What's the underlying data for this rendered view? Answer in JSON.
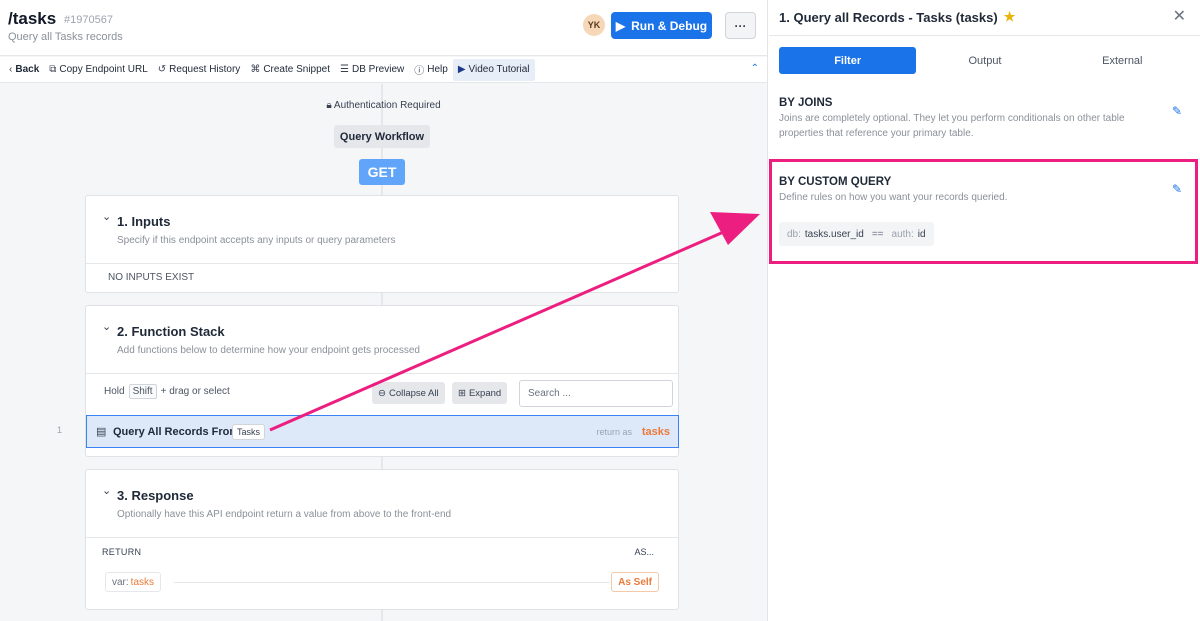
{
  "header": {
    "route": "/tasks",
    "route_id": "#1970567",
    "description": "Query all Tasks records",
    "avatar": "YK",
    "run_label": "Run & Debug",
    "more_label": "···"
  },
  "toolbar": {
    "items": [
      {
        "icon": "‹",
        "label": "Back"
      },
      {
        "icon": "⧉",
        "label": "Copy Endpoint URL"
      },
      {
        "icon": "↺",
        "label": "Request History"
      },
      {
        "icon": "⌘",
        "label": "Create Snippet"
      },
      {
        "icon": "☰",
        "label": "DB Preview"
      },
      {
        "icon": "ⓘ",
        "label": "Help"
      },
      {
        "icon": "▶",
        "label": "Video Tutorial"
      }
    ]
  },
  "flow": {
    "auth_label": "Authentication Required",
    "workflow_label": "Query Workflow",
    "method": "GET"
  },
  "inputs_card": {
    "title": "1. Inputs",
    "subtitle": "Specify if this endpoint accepts any inputs or query parameters",
    "empty_text": "NO INPUTS EXIST"
  },
  "function_card": {
    "title": "2. Function Stack",
    "subtitle": "Add functions below to determine how your endpoint gets processed",
    "hold_label": "Hold",
    "shift_key": "Shift",
    "drag_label": "+ drag or select",
    "collapse_label": "Collapse All",
    "expand_label": "Expand",
    "search_placeholder": "Search ...",
    "line_number": "1",
    "function_name": "Query All Records From",
    "table_badge": "Tasks",
    "return_label": "return as",
    "return_var": "tasks"
  },
  "response_card": {
    "title": "3. Response",
    "subtitle": "Optionally have this API endpoint return a value from above to the front-end",
    "return_header": "RETURN",
    "as_header": "AS...",
    "var_prefix": "var:",
    "var_name": "tasks",
    "as_value": "As Self"
  },
  "panel": {
    "title": "1.  Query all Records - Tasks (tasks)",
    "tabs": [
      "Filter",
      "Output",
      "External"
    ],
    "joins_title": "BY JOINS",
    "joins_desc": "Joins are completely optional. They let you perform conditionals on other table properties that reference your primary table.",
    "custom_title": "BY CUSTOM QUERY",
    "custom_desc": "Define rules on how you want your records queried.",
    "condition": {
      "left_prefix": "db:",
      "left_value": "tasks.user_id",
      "operator": "==",
      "right_prefix": "auth:",
      "right_value": "id"
    }
  },
  "colors": {
    "accent": "#1a73e8",
    "highlight": "#ec1e7f",
    "var_orange": "#ea7a3a"
  }
}
